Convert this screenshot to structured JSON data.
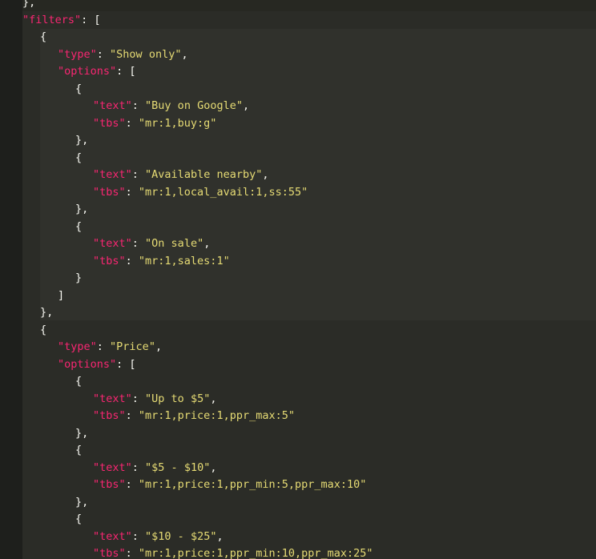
{
  "editor": {
    "lines": [
      {
        "indent": 28,
        "parts": [
          {
            "t": "},",
            "c": "pun"
          }
        ]
      },
      {
        "indent": 28,
        "parts": [
          {
            "t": "\"filters\"",
            "c": "key"
          },
          {
            "t": ": [",
            "c": "pun"
          }
        ]
      },
      {
        "indent": 50,
        "parts": [
          {
            "t": "{",
            "c": "pun"
          }
        ]
      },
      {
        "indent": 72,
        "parts": [
          {
            "t": "\"type\"",
            "c": "key"
          },
          {
            "t": ": ",
            "c": "pun"
          },
          {
            "t": "\"Show only\"",
            "c": "str"
          },
          {
            "t": ",",
            "c": "pun"
          }
        ]
      },
      {
        "indent": 72,
        "parts": [
          {
            "t": "\"options\"",
            "c": "key"
          },
          {
            "t": ": [",
            "c": "pun"
          }
        ]
      },
      {
        "indent": 94,
        "parts": [
          {
            "t": "{",
            "c": "pun"
          }
        ]
      },
      {
        "indent": 116,
        "parts": [
          {
            "t": "\"text\"",
            "c": "key"
          },
          {
            "t": ": ",
            "c": "pun"
          },
          {
            "t": "\"Buy on Google\"",
            "c": "str"
          },
          {
            "t": ",",
            "c": "pun"
          }
        ]
      },
      {
        "indent": 116,
        "parts": [
          {
            "t": "\"tbs\"",
            "c": "key"
          },
          {
            "t": ": ",
            "c": "pun"
          },
          {
            "t": "\"mr:1,buy:g\"",
            "c": "str"
          }
        ]
      },
      {
        "indent": 94,
        "parts": [
          {
            "t": "},",
            "c": "pun"
          }
        ]
      },
      {
        "indent": 94,
        "parts": [
          {
            "t": "{",
            "c": "pun"
          }
        ]
      },
      {
        "indent": 116,
        "parts": [
          {
            "t": "\"text\"",
            "c": "key"
          },
          {
            "t": ": ",
            "c": "pun"
          },
          {
            "t": "\"Available nearby\"",
            "c": "str"
          },
          {
            "t": ",",
            "c": "pun"
          }
        ]
      },
      {
        "indent": 116,
        "parts": [
          {
            "t": "\"tbs\"",
            "c": "key"
          },
          {
            "t": ": ",
            "c": "pun"
          },
          {
            "t": "\"mr:1,local_avail:1,ss:55\"",
            "c": "str"
          }
        ]
      },
      {
        "indent": 94,
        "parts": [
          {
            "t": "},",
            "c": "pun"
          }
        ]
      },
      {
        "indent": 94,
        "parts": [
          {
            "t": "{",
            "c": "pun"
          }
        ]
      },
      {
        "indent": 116,
        "parts": [
          {
            "t": "\"text\"",
            "c": "key"
          },
          {
            "t": ": ",
            "c": "pun"
          },
          {
            "t": "\"On sale\"",
            "c": "str"
          },
          {
            "t": ",",
            "c": "pun"
          }
        ]
      },
      {
        "indent": 116,
        "parts": [
          {
            "t": "\"tbs\"",
            "c": "key"
          },
          {
            "t": ": ",
            "c": "pun"
          },
          {
            "t": "\"mr:1,sales:1\"",
            "c": "str"
          }
        ]
      },
      {
        "indent": 94,
        "parts": [
          {
            "t": "}",
            "c": "pun"
          }
        ]
      },
      {
        "indent": 72,
        "parts": [
          {
            "t": "]",
            "c": "pun"
          }
        ]
      },
      {
        "indent": 50,
        "parts": [
          {
            "t": "},",
            "c": "pun"
          }
        ]
      },
      {
        "indent": 50,
        "parts": [
          {
            "t": "{",
            "c": "pun"
          }
        ]
      },
      {
        "indent": 72,
        "parts": [
          {
            "t": "\"type\"",
            "c": "key"
          },
          {
            "t": ": ",
            "c": "pun"
          },
          {
            "t": "\"Price\"",
            "c": "str"
          },
          {
            "t": ",",
            "c": "pun"
          }
        ]
      },
      {
        "indent": 72,
        "parts": [
          {
            "t": "\"options\"",
            "c": "key"
          },
          {
            "t": ": [",
            "c": "pun"
          }
        ]
      },
      {
        "indent": 94,
        "parts": [
          {
            "t": "{",
            "c": "pun"
          }
        ]
      },
      {
        "indent": 116,
        "parts": [
          {
            "t": "\"text\"",
            "c": "key"
          },
          {
            "t": ": ",
            "c": "pun"
          },
          {
            "t": "\"Up to $5\"",
            "c": "str"
          },
          {
            "t": ",",
            "c": "pun"
          }
        ]
      },
      {
        "indent": 116,
        "parts": [
          {
            "t": "\"tbs\"",
            "c": "key"
          },
          {
            "t": ": ",
            "c": "pun"
          },
          {
            "t": "\"mr:1,price:1,ppr_max:5\"",
            "c": "str"
          }
        ]
      },
      {
        "indent": 94,
        "parts": [
          {
            "t": "},",
            "c": "pun"
          }
        ]
      },
      {
        "indent": 94,
        "parts": [
          {
            "t": "{",
            "c": "pun"
          }
        ]
      },
      {
        "indent": 116,
        "parts": [
          {
            "t": "\"text\"",
            "c": "key"
          },
          {
            "t": ": ",
            "c": "pun"
          },
          {
            "t": "\"$5 - $10\"",
            "c": "str"
          },
          {
            "t": ",",
            "c": "pun"
          }
        ]
      },
      {
        "indent": 116,
        "parts": [
          {
            "t": "\"tbs\"",
            "c": "key"
          },
          {
            "t": ": ",
            "c": "pun"
          },
          {
            "t": "\"mr:1,price:1,ppr_min:5,ppr_max:10\"",
            "c": "str"
          }
        ]
      },
      {
        "indent": 94,
        "parts": [
          {
            "t": "},",
            "c": "pun"
          }
        ]
      },
      {
        "indent": 94,
        "parts": [
          {
            "t": "{",
            "c": "pun"
          }
        ]
      },
      {
        "indent": 116,
        "parts": [
          {
            "t": "\"text\"",
            "c": "key"
          },
          {
            "t": ": ",
            "c": "pun"
          },
          {
            "t": "\"$10 - $25\"",
            "c": "str"
          },
          {
            "t": ",",
            "c": "pun"
          }
        ]
      },
      {
        "indent": 116,
        "parts": [
          {
            "t": "\"tbs\"",
            "c": "key"
          },
          {
            "t": ": ",
            "c": "pun"
          },
          {
            "t": "\"mr:1,price:1,ppr_min:10,ppr_max:25\"",
            "c": "str"
          }
        ]
      }
    ]
  },
  "colors": {
    "background": "#272822",
    "key": "#f92672",
    "string": "#e6db74",
    "punctuation": "#f8f8f2"
  }
}
